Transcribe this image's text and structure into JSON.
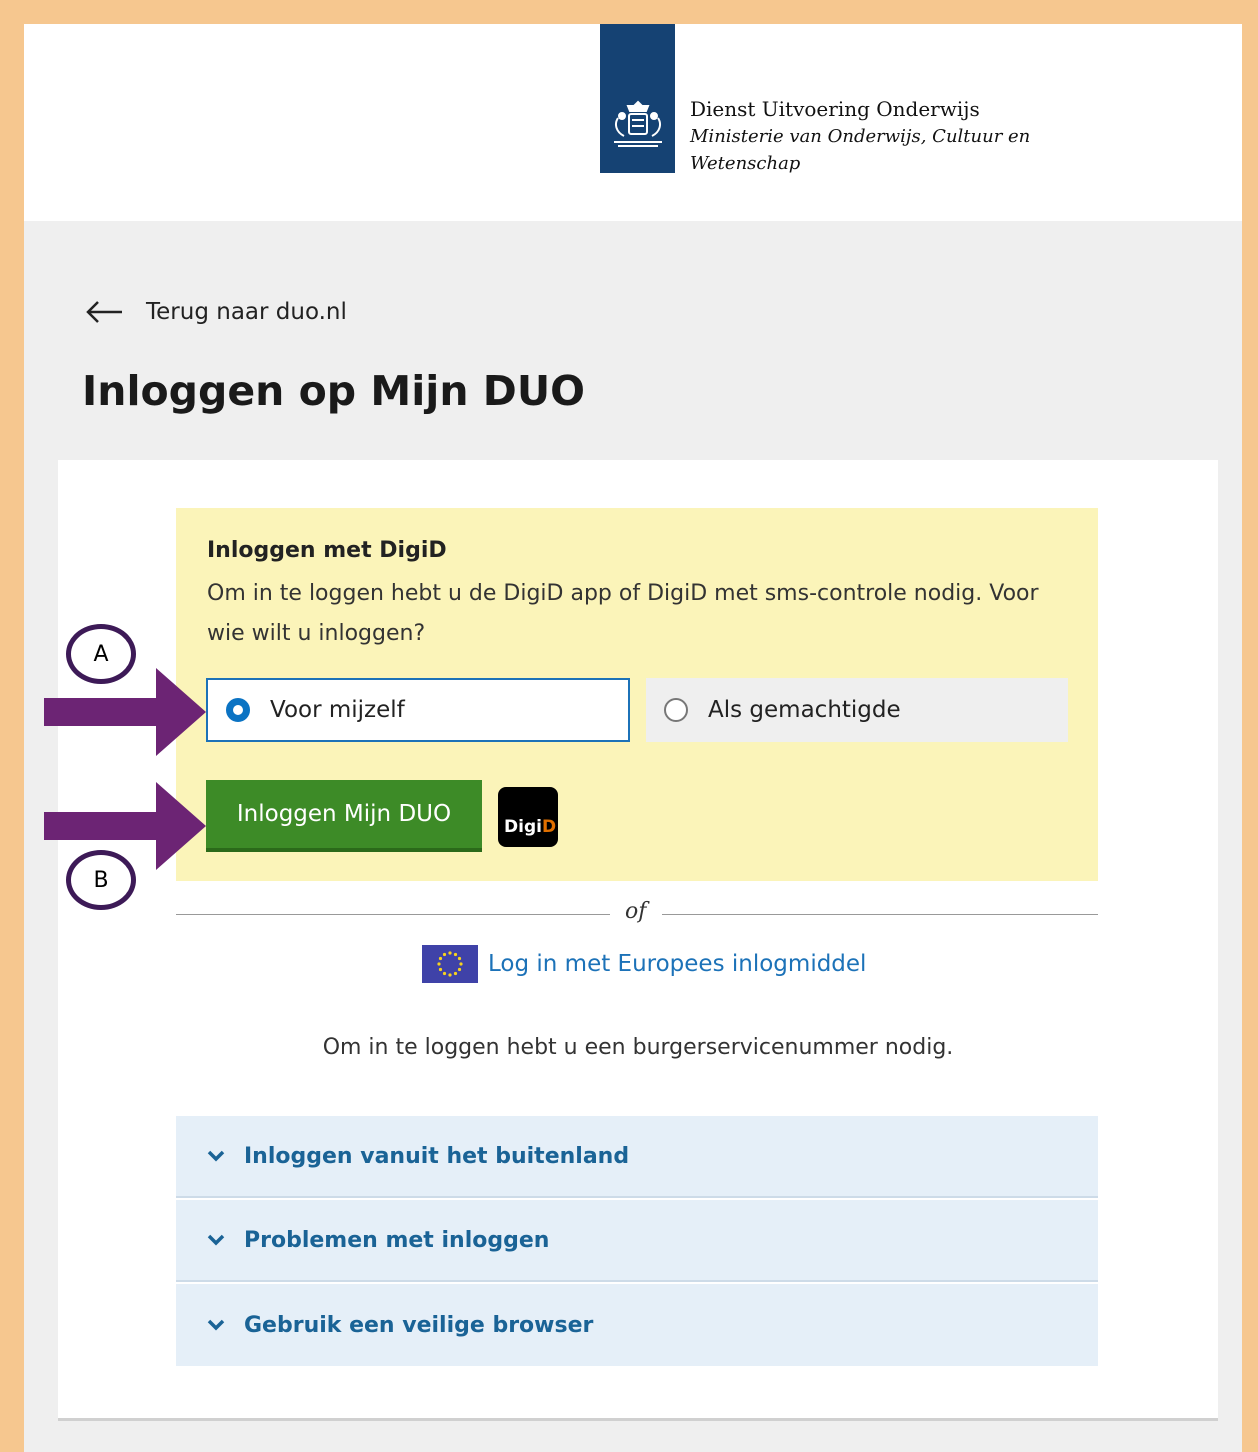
{
  "header": {
    "org_line1": "Dienst Uitvoering Onderwijs",
    "org_line2": "Ministerie van Onderwijs, Cultuur en",
    "org_line3": "Wetenschap",
    "brand_color": "#154273"
  },
  "back_link": {
    "label": "Terug naar duo.nl",
    "icon": "arrow-left-icon"
  },
  "page_title": "Inloggen op Mijn DUO",
  "digid": {
    "title": "Inloggen met DigiD",
    "description": "Om in te loggen hebt u de DigiD app of DigiD met sms-controle nodig. Voor wie wilt u inloggen?",
    "options": [
      {
        "label": "Voor mijzelf",
        "selected": true
      },
      {
        "label": "Als gemachtigde",
        "selected": false
      }
    ],
    "login_button": "Inloggen Mijn DUO",
    "logo_text_a": "Digi",
    "logo_text_b": "D",
    "box_color": "#fbf4b9",
    "button_color": "#3d8b27"
  },
  "divider_text": "of",
  "eu_login": {
    "label": "Log in met Europees inlogmiddel",
    "icon": "eu-flag-icon"
  },
  "bsn_note": "Om in te loggen hebt u een burgerservicenummer nodig.",
  "accordion": [
    {
      "label": "Inloggen vanuit het buitenland"
    },
    {
      "label": "Problemen met inloggen"
    },
    {
      "label": "Gebruik een veilige browser"
    }
  ],
  "annotations": {
    "a_label": "A",
    "b_label": "B",
    "arrow_color": "#6c2474"
  }
}
